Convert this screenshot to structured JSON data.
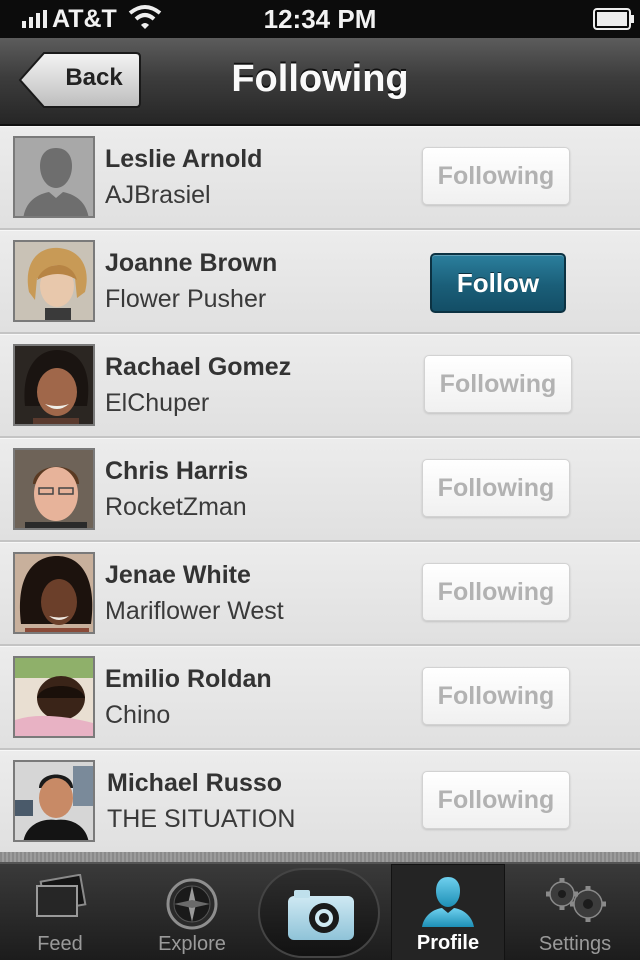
{
  "status_bar": {
    "carrier": "AT&T",
    "time": "12:34 PM"
  },
  "nav": {
    "back_label": "Back",
    "title": "Following"
  },
  "users": [
    {
      "name": "Leslie Arnold",
      "handle": "AJBrasiel",
      "button": "Following",
      "avatar": "silhouette"
    },
    {
      "name": "Joanne Brown",
      "handle": "Flower Pusher",
      "button": "Follow",
      "avatar": "photo"
    },
    {
      "name": "Rachael Gomez",
      "handle": "ElChuper",
      "button": "Following",
      "avatar": "photo"
    },
    {
      "name": "Chris Harris",
      "handle": "RocketZman",
      "button": "Following",
      "avatar": "photo"
    },
    {
      "name": "Jenae White",
      "handle": "Mariflower West",
      "button": "Following",
      "avatar": "photo"
    },
    {
      "name": "Emilio Roldan",
      "handle": "Chino",
      "button": "Following",
      "avatar": "photo"
    },
    {
      "name": "Michael Russo",
      "handle": "THE SITUATION",
      "button": "Following",
      "avatar": "photo"
    }
  ],
  "tabs": [
    {
      "label": "Feed",
      "icon": "feed-icon"
    },
    {
      "label": "Explore",
      "icon": "compass-icon"
    },
    {
      "label": "",
      "icon": "camera-icon"
    },
    {
      "label": "Profile",
      "icon": "person-icon",
      "active": true
    },
    {
      "label": "Settings",
      "icon": "gears-icon"
    }
  ],
  "colors": {
    "follow_button": "#1a5e78",
    "profile_icon": "#3bb3d8"
  }
}
